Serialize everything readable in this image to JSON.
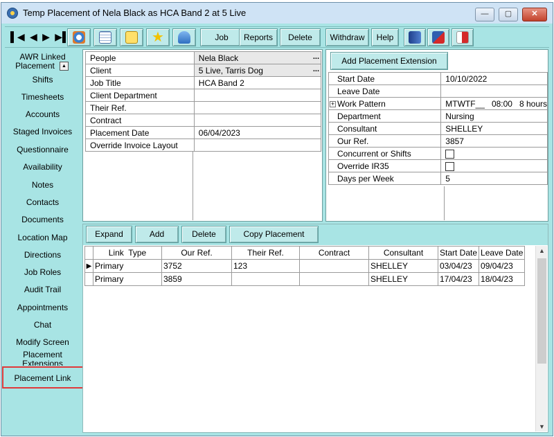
{
  "window": {
    "title": "Temp Placement of Nela Black as HCA Band 2 at 5 Live",
    "controls": {
      "minimize": "—",
      "maximize": "▢",
      "close": "✕"
    }
  },
  "toolbar": {
    "nav_arrows": [
      "▌◀",
      "◀",
      "▶",
      "▶▌"
    ],
    "icons": [
      "refresh-icon",
      "calendar-icon",
      "note-icon",
      "star-icon",
      "phone-icon"
    ],
    "buttons": [
      "Job",
      "Reports",
      "Delete",
      "Withdraw",
      "Help"
    ],
    "right_icons": [
      "contact-book-icon",
      "export-icon",
      "exit-icon"
    ]
  },
  "sidebar": {
    "items": [
      {
        "label_line1": "AWR Linked",
        "label_line2": "Placement"
      },
      {
        "label": "Shifts"
      },
      {
        "label": "Timesheets"
      },
      {
        "label": "Accounts"
      },
      {
        "label": "Staged Invoices"
      },
      {
        "label": "Questionnaire"
      },
      {
        "label": "Availability"
      },
      {
        "label": "Notes"
      },
      {
        "label": "Contacts"
      },
      {
        "label": "Documents"
      },
      {
        "label": "Location Map"
      },
      {
        "label": "Directions"
      },
      {
        "label": "Job Roles"
      },
      {
        "label": "Audit Trail"
      },
      {
        "label": "Appointments"
      },
      {
        "label": "Chat"
      },
      {
        "label": "Modify Screen"
      },
      {
        "label_line1": "Placement",
        "label_line2": "Extensions"
      },
      {
        "label": "Placement Link"
      }
    ],
    "selected": "Placement Link"
  },
  "left_form": {
    "rows": [
      {
        "label": "People",
        "value": "Nela Black",
        "lookup": "..."
      },
      {
        "label": "Client",
        "value": "5 Live, Tarris Dog",
        "lookup": "..."
      },
      {
        "label": "Job Title",
        "value": "HCA Band 2"
      },
      {
        "label": "Client Department",
        "value": ""
      },
      {
        "label": "Their Ref.",
        "value": ""
      },
      {
        "label": "Contract",
        "value": ""
      },
      {
        "label": "Placement Date",
        "value": "06/04/2023"
      },
      {
        "label": "Override Invoice Layout",
        "value": ""
      }
    ]
  },
  "right_form": {
    "add_extension_label": "Add Placement Extension",
    "rows": [
      {
        "label": "Start Date",
        "value": "10/10/2022"
      },
      {
        "label": "Leave Date",
        "value": ""
      },
      {
        "label": "Work Pattern",
        "value": "MTWTF__   08:00   8 hours",
        "expander": "+"
      },
      {
        "label": "Department",
        "value": "Nursing"
      },
      {
        "label": "Consultant",
        "value": "SHELLEY"
      },
      {
        "label": "Our Ref.",
        "value": "3857"
      },
      {
        "label": "Concurrent or Shifts",
        "value": "",
        "checkbox": true,
        "checked": false
      },
      {
        "label": "Override IR35",
        "value": "",
        "checkbox": true,
        "checked": false
      },
      {
        "label": "Days per Week",
        "value": "5"
      }
    ]
  },
  "links": {
    "buttons": [
      "Expand",
      "Add",
      "Delete",
      "Copy Placement"
    ],
    "columns": [
      "Link  Type",
      "Our Ref.",
      "Their Ref.",
      "Contract",
      "Consultant",
      "Start Date",
      "Leave Date"
    ],
    "rows": [
      {
        "indicator": "▶",
        "cells": [
          "Primary",
          "3752",
          "123",
          "",
          "SHELLEY",
          "03/04/23",
          "09/04/23"
        ]
      },
      {
        "indicator": "",
        "cells": [
          "Primary",
          "3859",
          "",
          "",
          "SHELLEY",
          "17/04/23",
          "18/04/23"
        ]
      }
    ]
  }
}
